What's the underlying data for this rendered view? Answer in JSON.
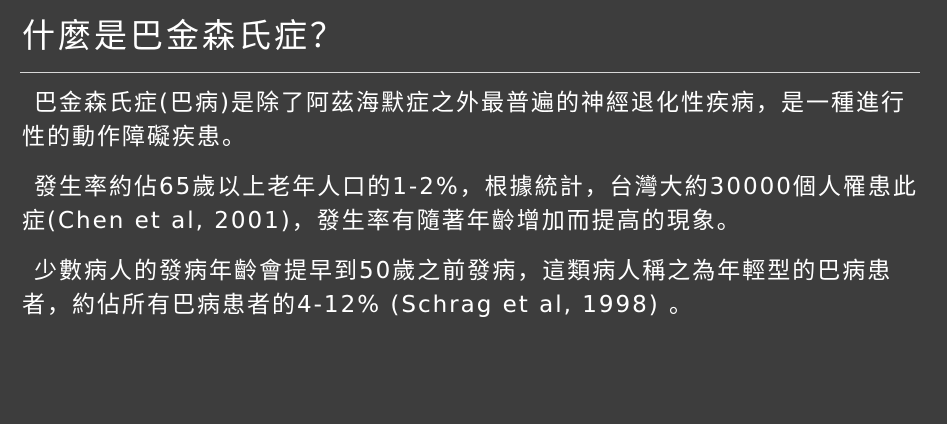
{
  "slide": {
    "title": "什麼是巴金森氏症？",
    "paragraphs": [
      "巴金森氏症(巴病)是除了阿茲海默症之外最普遍的神經退化性疾病，是一種進行性的動作障礙疾患。",
      "發生率約佔65歲以上老年人口的1-2%，根據統計，台灣大約30000個人罹患此症(Chen et al, 2001)，發生率有隨著年齡增加而提高的現象。",
      "少數病人的發病年齡會提早到50歲之前發病，這類病人稱之為年輕型的巴病患者，約佔所有巴病患者的4-12% (Schrag et al, 1998) 。"
    ]
  },
  "colors": {
    "background": "#3d3d3d",
    "text": "#ffffff",
    "rule": "#d8d8d8"
  }
}
